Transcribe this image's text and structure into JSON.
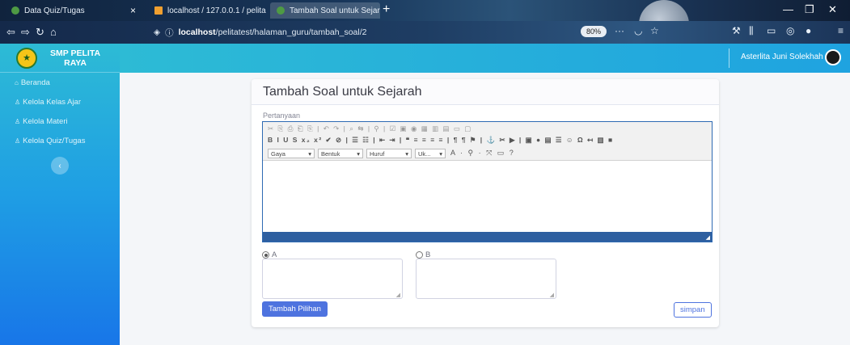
{
  "browser": {
    "tabs": [
      {
        "label": "Data Quiz/Tugas",
        "close": "×"
      },
      {
        "label": "localhost / 127.0.0.1 / pelita / ",
        "close": "×"
      },
      {
        "label": "Tambah Soal untuk Sejarah",
        "close": "×"
      }
    ],
    "new_tab": "+",
    "url_host": "localhost",
    "url_path": "/pelitatest/halaman_guru/tambah_soal/2",
    "zoom": "80%",
    "page_actions": "···",
    "accent_tab": "#4e9a44",
    "accent_pma": "#f0a030"
  },
  "sidebar": {
    "brand": "SMP PELITA RAYA",
    "brand_line1": "SMP PELITA",
    "brand_line2": "RAYA",
    "items": [
      {
        "label": "Beranda",
        "icon": "home-icon"
      },
      {
        "label": "Kelola Kelas Ajar",
        "icon": "user-icon"
      },
      {
        "label": "Kelola Materi",
        "icon": "user-icon"
      },
      {
        "label": "Kelola Quiz/Tugas",
        "icon": "user-icon"
      }
    ],
    "toggle": "‹"
  },
  "topbar": {
    "user_name": "Asterlita Juni Solekhah"
  },
  "form": {
    "title": "Tambah Soal untuk Sejarah",
    "question_label": "Pertanyaan",
    "editor": {
      "row1": "✂ ⎘ ⎙ ⎗ ⎘ | ↶ ↷ | ⌕ ⇆ | ⚲ | ☑ ▣ ◉ ▦ ▥ ▤ ▭ ▢",
      "row2": "B I U S x₂ x² ✔ ⊘ | ☰ ☷ | ⇤ ⇥ | ❝ ≡ ≡ ≡ ≡ | ¶ ¶ ⚑ | ⚓ ✂ ▶ | ▣ ● ▤ ☰ ☺ Ω ↤ ▥ ■",
      "styles": [
        "Gaya",
        "Bentuk",
        "Huruf",
        "Uk..."
      ],
      "extra": "A · ⚲ · ⤧ ▭ ?"
    },
    "options": [
      {
        "label": "A",
        "selected": true
      },
      {
        "label": "B",
        "selected": false
      }
    ],
    "add_choice": "Tambah Pilihan",
    "save": "simpan"
  }
}
